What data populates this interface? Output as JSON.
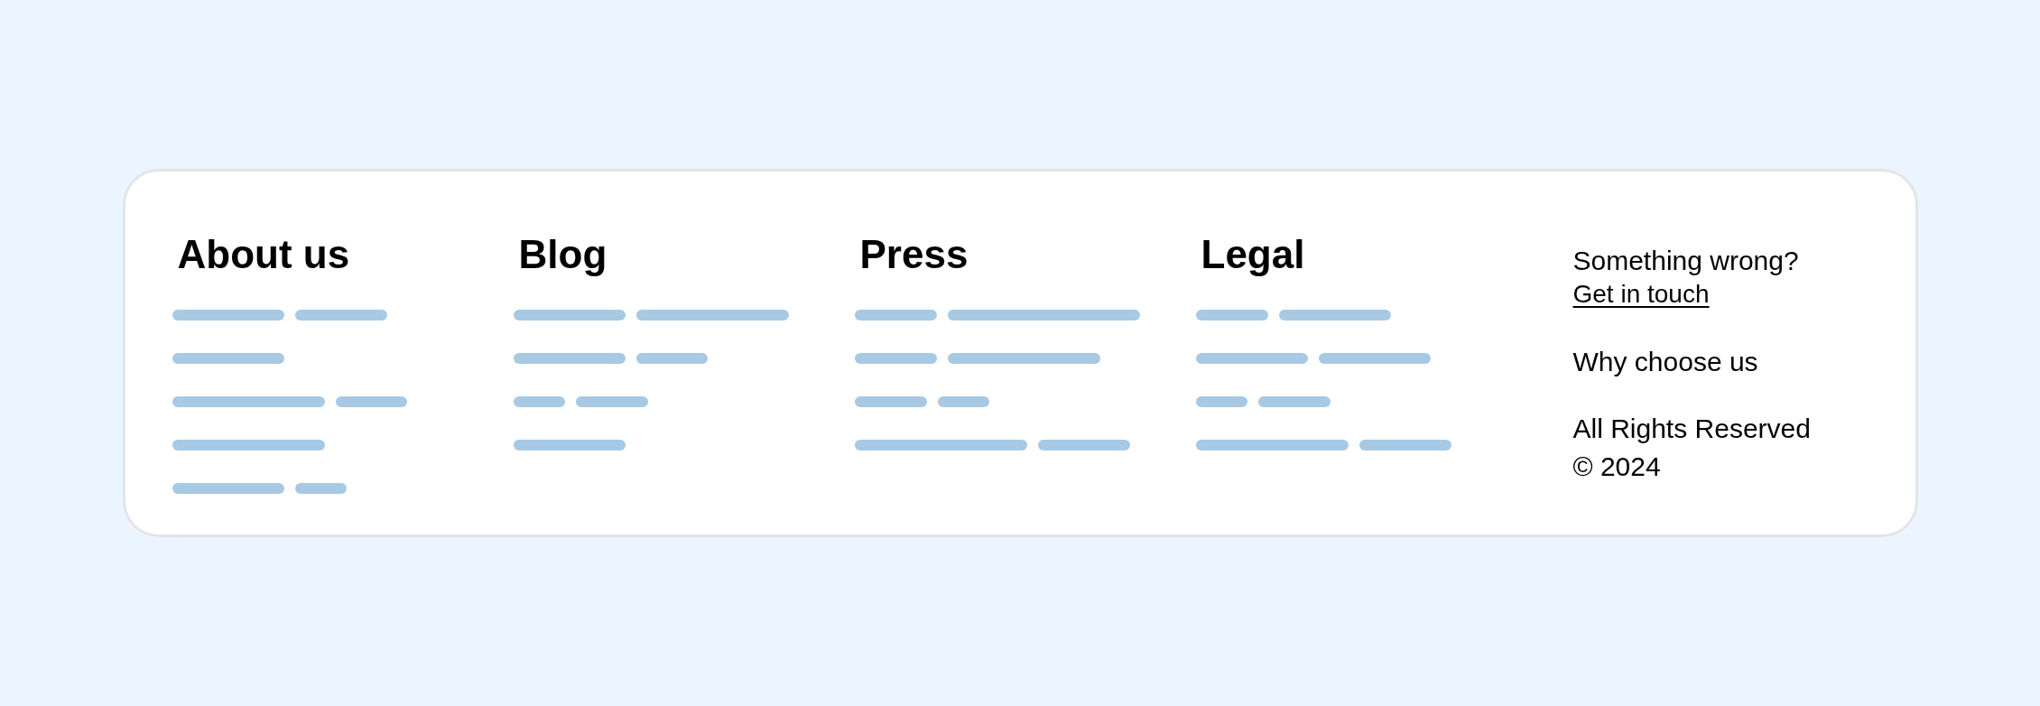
{
  "footer": {
    "columns": [
      {
        "heading": "About us"
      },
      {
        "heading": "Blog"
      },
      {
        "heading": "Press"
      },
      {
        "heading": "Legal"
      }
    ],
    "contact": {
      "prompt": "Something wrong?",
      "link": "Get in touch"
    },
    "links": [
      "Why choose us"
    ],
    "legal": [
      "All Rights Reserved",
      "© 2024"
    ]
  }
}
